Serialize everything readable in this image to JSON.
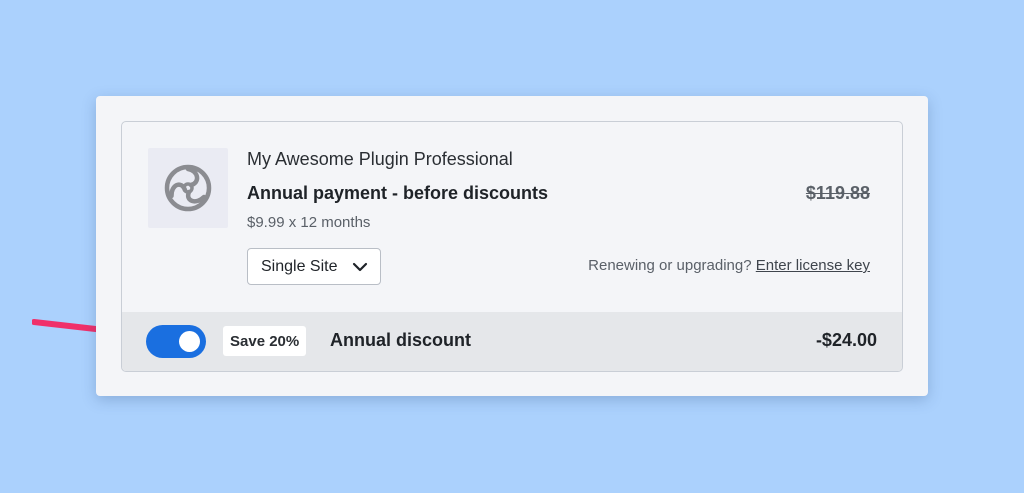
{
  "product": {
    "name": "My Awesome Plugin Professional",
    "payment_title": "Annual payment - before discounts",
    "breakdown": "$9.99 x 12 months",
    "original_price": "$119.88",
    "icon": "plugin-logo-icon"
  },
  "license_select": {
    "value": "Single Site",
    "icon": "chevron-down-icon"
  },
  "license": {
    "prompt": "Renewing or upgrading?",
    "link": "Enter license key"
  },
  "discount": {
    "toggle_on": true,
    "badge": "Save 20%",
    "label": "Annual discount",
    "amount": "-$24.00"
  },
  "annotation": {
    "icon": "pointer-arrow-icon",
    "color": "#f0306a"
  },
  "colors": {
    "background": "#abd1fd",
    "toggle_accent": "#1a6fe0",
    "discount_bar": "#e5e7ea"
  }
}
